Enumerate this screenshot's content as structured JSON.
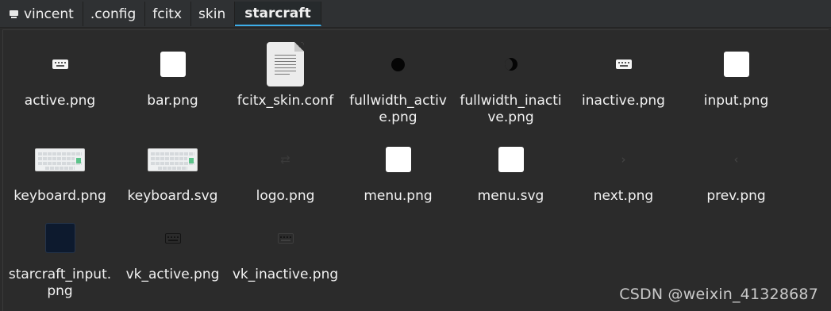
{
  "breadcrumb": [
    {
      "label": "vincent",
      "icon": "computer-icon"
    },
    {
      "label": ".config"
    },
    {
      "label": "fcitx"
    },
    {
      "label": "skin"
    },
    {
      "label": "starcraft"
    }
  ],
  "files": [
    {
      "name": "active.png",
      "icon": "keyboard-white-icon"
    },
    {
      "name": "bar.png",
      "icon": "white-square-icon"
    },
    {
      "name": "fcitx_skin.conf",
      "icon": "text-document-icon"
    },
    {
      "name": "fullwidth_active.png",
      "icon": "full-circle-icon"
    },
    {
      "name": "fullwidth_inactive.png",
      "icon": "half-moon-icon"
    },
    {
      "name": "inactive.png",
      "icon": "keyboard-white-icon"
    },
    {
      "name": "input.png",
      "icon": "white-square-icon"
    },
    {
      "name": "keyboard.png",
      "icon": "keyboard-thumbnail-icon"
    },
    {
      "name": "keyboard.svg",
      "icon": "keyboard-thumbnail-icon"
    },
    {
      "name": "logo.png",
      "icon": "swap-arrows-icon"
    },
    {
      "name": "menu.png",
      "icon": "white-square-icon"
    },
    {
      "name": "menu.svg",
      "icon": "white-square-icon"
    },
    {
      "name": "next.png",
      "icon": "chevron-right-icon"
    },
    {
      "name": "prev.png",
      "icon": "chevron-left-icon"
    },
    {
      "name": "starcraft_input.png",
      "icon": "navy-square-icon"
    },
    {
      "name": "vk_active.png",
      "icon": "keyboard-dark-icon"
    },
    {
      "name": "vk_inactive.png",
      "icon": "keyboard-dark-dim-icon"
    }
  ],
  "watermark": "CSDN @weixin_41328687"
}
